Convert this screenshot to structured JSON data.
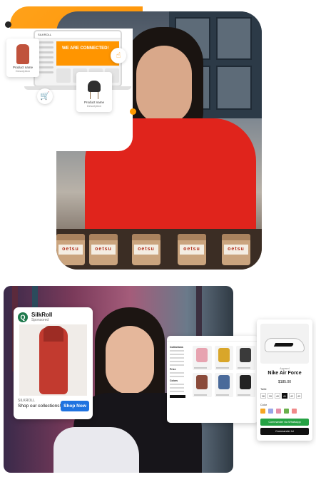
{
  "top_scene": {
    "laptop": {
      "brand": "SILKROLL",
      "hero_text": "WE ARE CONNECTED!"
    },
    "product_card_coat": {
      "name": "Product name",
      "price": "Description"
    },
    "product_card_chair": {
      "name": "Product name",
      "price": "Description"
    },
    "jar_label": "oetsu",
    "icons": [
      "touch-icon",
      "cart-icon"
    ]
  },
  "ad": {
    "brand": "SilkRoll",
    "sponsored": "Sponsored",
    "label": "SILKROLL",
    "text": "Shop our collections!",
    "cta": "Shop Now",
    "colors": {
      "cta": "#1f73e0",
      "logo": "#1f7a4d"
    }
  },
  "shop_page": {
    "filter_title": "Collections",
    "filter_title_2": "Price",
    "filter_title_3": "Colors"
  },
  "product_detail": {
    "brand": "Apparel",
    "name": "Nike Air Force",
    "price": "$185.00",
    "size_label": "Taille",
    "sizes": [
      "38",
      "39",
      "40",
      "41",
      "42",
      "43"
    ],
    "selected_size": "41",
    "color_label": "Color",
    "swatches": [
      "#f5a623",
      "#9aa6e8",
      "#e58fa8",
      "#6ab04c",
      "#f08a8a"
    ],
    "whatsapp_btn": "Commander via WhatsApp",
    "buy_btn": "Commander Ici"
  }
}
